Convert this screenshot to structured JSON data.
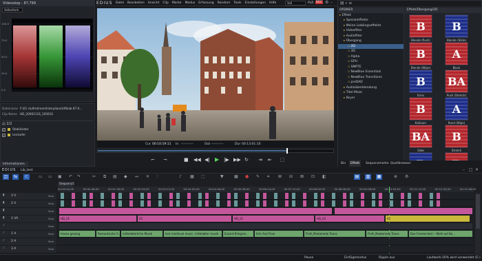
{
  "app": {
    "name": "EDIUS",
    "logo": "EDIUS"
  },
  "menu": {
    "items": [
      "Datei",
      "Bearbeiten",
      "Ansicht",
      "Clip",
      "Marke",
      "Modus",
      "Erfassung",
      "Rendern",
      "Tools",
      "Einstellungen",
      "Hilfe"
    ]
  },
  "top": {
    "plr_label": "PLR",
    "rec_label": "REC",
    "mode_value": "Voll"
  },
  "videoscope": {
    "title": "Videoskop - 87,799",
    "mode": "Vollenform",
    "y_labels": [
      "100.0",
      "75.0",
      "50.0",
      "25.0",
      "0.0"
    ]
  },
  "info": {
    "rows": [
      {
        "key": "Dateiname",
        "value": "F:\\01 clulfrahmen\\Interpliane\\Ufbiab 87-0..."
      },
      {
        "key": "Clip-Name",
        "value": "HD_20061116_105616"
      }
    ],
    "counter": "2/2",
    "layers": [
      {
        "label": "Stabilisator",
        "checked": true
      },
      {
        "label": "Levizufer",
        "checked": true
      }
    ],
    "tab": "Informationen"
  },
  "player": {
    "tc_cur_label": "Cur",
    "tc_cur": "00:10:19:11",
    "tc_in_label": "In",
    "tc_in": "--:--:--:--",
    "tc_out_label": "Out",
    "tc_out": "--:--:--:--",
    "tc_dur_label": "Dur",
    "tc_dur": "00:13:01:10"
  },
  "bin": {
    "tree_header": "ORDNER",
    "tree": [
      {
        "label": "Effekt",
        "level": 0
      },
      {
        "label": "Spezialeffekte",
        "level": 1
      },
      {
        "label": "Meine Lieblingseffekte",
        "level": 1
      },
      {
        "label": "Videofilter",
        "level": 1
      },
      {
        "label": "Audiofilter",
        "level": 1
      },
      {
        "label": "Übergang",
        "level": 1
      },
      {
        "label": "2D",
        "level": 2,
        "selected": true
      },
      {
        "label": "3D",
        "level": 2
      },
      {
        "label": "Alpha",
        "level": 2
      },
      {
        "label": "GPU",
        "level": 2
      },
      {
        "label": "SMPTE",
        "level": 2
      },
      {
        "label": "NewBlue Essentials",
        "level": 2
      },
      {
        "label": "NewBlue Transitions",
        "level": 2
      },
      {
        "label": "proDAD",
        "level": 2
      },
      {
        "label": "Audioüberblendung",
        "level": 1
      },
      {
        "label": "Titel-Mixer",
        "level": 1
      },
      {
        "label": "Keyer",
        "level": 1
      }
    ],
    "path": "Effekt/Übergang/2D",
    "effects": [
      {
        "label": "Blende (Push)",
        "glyph": "B"
      },
      {
        "label": "Blende (Slide)",
        "glyph": "B"
      },
      {
        "label": "Blende (Wipe)",
        "glyph": "B"
      },
      {
        "label": "Block",
        "glyph": "A"
      },
      {
        "label": "Kreis",
        "glyph": "B"
      },
      {
        "label": "Push (Stretch)",
        "glyph": "BA"
      },
      {
        "label": "Kalinanr",
        "glyph": "B"
      },
      {
        "label": "Rand (Wipe)",
        "glyph": "A"
      },
      {
        "label": "Slide",
        "glyph": "BA"
      },
      {
        "label": "Stretch",
        "glyph": "B"
      },
      {
        "label": "",
        "glyph": "B"
      },
      {
        "label": "",
        "glyph": "B"
      }
    ],
    "tabs": [
      "Bin",
      "Effekt",
      "Sequenzmarke",
      "Quellbrowser"
    ]
  },
  "timeline": {
    "title": "EDIUS",
    "project": "Lib_test",
    "sequence_tab": "Sequenz1",
    "ruler": [
      "00:00:00;00",
      "00:00:48;00",
      "00:01:36;00",
      "00:02:24;00",
      "00:03:12;00",
      "00:04:00;00",
      "00:04:48;00",
      "00:05:36;00",
      "00:06:24;00",
      "00:07:12;00",
      "00:08:00;00",
      "00:08:48;00",
      "00:09:36;00",
      "00:10:24;00",
      "00:11:12;00",
      "00:12:00;00",
      "00:12:48;00"
    ],
    "tracks": [
      {
        "label": "3 V",
        "type": "v"
      },
      {
        "label": "2 V",
        "type": "v"
      },
      {
        "label": "",
        "type": "v"
      },
      {
        "label": "1 VA",
        "type": "va"
      },
      {
        "label": "",
        "type": "a"
      },
      {
        "label": "1 A",
        "type": "a"
      },
      {
        "label": "2 A",
        "type": "a"
      },
      {
        "label": "3 A",
        "type": "a"
      }
    ],
    "va_clips": [
      "HD_01",
      "02",
      "HD_01",
      "HD_02",
      "02"
    ],
    "audio_clips": [
      "trasse gesang",
      "Romantische S...",
      "mittelalterliche Musik",
      "test medieval music, mittelalter musik ...",
      "Eckard Elmgren...",
      "Erik And Flow",
      "Flott_Madamedo Tanec",
      "Flott_Madamedo Tanec",
      "Das Frankenlied -- Wohl auf Ba..."
    ],
    "solo_labels": [
      "Solo",
      "Solo",
      "Solo",
      "Solo",
      "Solo",
      "Solo",
      "Solo",
      "Solo"
    ]
  },
  "status": {
    "pause": "Pause",
    "mode": "Einfügemodus",
    "ripple": "Ripple aus",
    "disk": "Laufwerk:16% wird verwendet (E:)"
  },
  "colors": {
    "accent": "#3a6ea5",
    "clip_pink": "#c4579c",
    "clip_green": "#6da56d",
    "clip_yellow": "#c9b83c",
    "clip_orange": "#c76a28"
  }
}
